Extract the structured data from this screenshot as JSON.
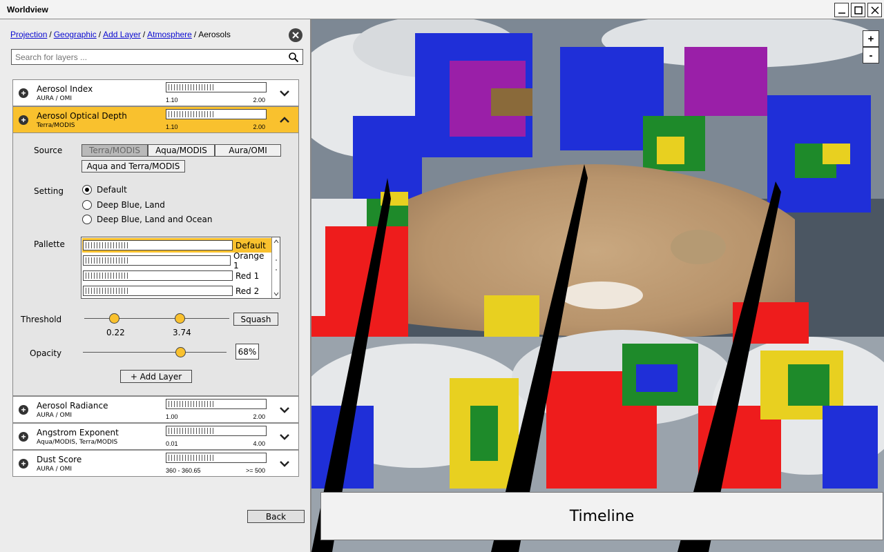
{
  "window": {
    "title": "Worldview"
  },
  "breadcrumb": {
    "items": [
      "Projection",
      "Geographic",
      "Add Layer",
      "Atmosphere"
    ],
    "current": "Aerosols"
  },
  "search": {
    "placeholder": "Search for layers ..."
  },
  "layers": [
    {
      "name": "Aerosol Index",
      "source": "AURA / OMI",
      "min": "1.10",
      "max": "2.00"
    },
    {
      "name": "Aerosol Optical Depth",
      "source": "Terra/MODIS",
      "min": "1.10",
      "max": "2.00",
      "expanded": true
    },
    {
      "name": "Aerosol Radiance",
      "source": "AURA / OMI",
      "min": "1.00",
      "max": "2.00"
    },
    {
      "name": "Angstrom Exponent",
      "source": "Aqua/MODIS, Terra/MODIS",
      "min": "0.01",
      "max": "4.00"
    },
    {
      "name": "Dust Score",
      "source": "AURA / OMI",
      "min": "360 - 360.65",
      "max": ">= 500"
    }
  ],
  "detail": {
    "source_label": "Source",
    "sources": [
      "Terra/MODIS",
      "Aqua/MODIS",
      "Aura/OMI",
      "Aqua and Terra/MODIS"
    ],
    "selected_source": "Terra/MODIS",
    "setting_label": "Setting",
    "settings": [
      "Default",
      "Deep Blue, Land",
      "Deep Blue, Land and Ocean"
    ],
    "selected_setting": "Default",
    "palette_label": "Pallette",
    "palettes": [
      "Default",
      "Orange 1",
      "Red 1",
      "Red 2"
    ],
    "selected_palette": "Default",
    "threshold_label": "Threshold",
    "threshold_min": "0.22",
    "threshold_max": "3.74",
    "squash_label": "Squash",
    "opacity_label": "Opacity",
    "opacity_value": "68%",
    "opacity_fraction": 0.68,
    "add_layer_label": "+ Add Layer"
  },
  "back_label": "Back",
  "map": {
    "zoom_in": "+",
    "zoom_out": "-",
    "timeline_label": "Timeline"
  }
}
